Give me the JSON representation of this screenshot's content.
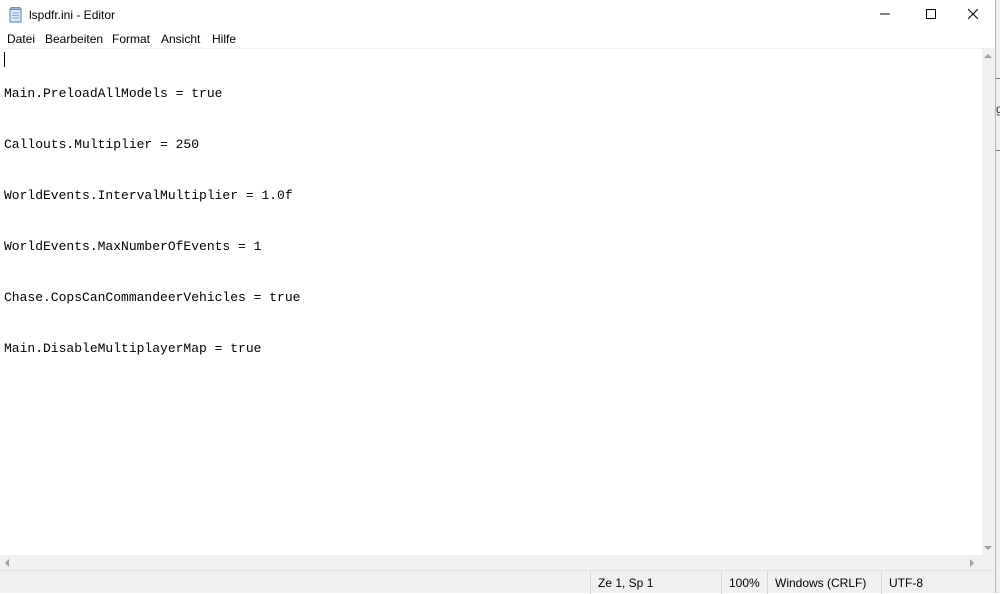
{
  "window": {
    "title": "lspdfr.ini - Editor",
    "icon": "notepad-icon"
  },
  "controls": {
    "minimize_icon": "minimize-icon",
    "maximize_icon": "maximize-icon",
    "close_icon": "close-icon"
  },
  "menu": {
    "items": [
      {
        "label": "Datei"
      },
      {
        "label": "Bearbeiten"
      },
      {
        "label": "Format"
      },
      {
        "label": "Ansicht"
      },
      {
        "label": "Hilfe"
      }
    ]
  },
  "editor": {
    "lines": [
      "Main.PreloadAllModels = true",
      "Callouts.Multiplier = 250",
      "WorldEvents.IntervalMultiplier = 1.0f",
      "WorldEvents.MaxNumberOfEvents = 1",
      "Chase.CopsCanCommandeerVehicles = true",
      "Main.DisableMultiplayerMap = true"
    ]
  },
  "statusbar": {
    "position": "Ze 1, Sp 1",
    "zoom": "100%",
    "line_endings": "Windows (CRLF)",
    "encoding": "UTF-8"
  },
  "background_window": {
    "partial_text": "g"
  },
  "colors": {
    "chrome_background": "#f0f0f0",
    "editor_background": "#ffffff",
    "text": "#000000"
  }
}
